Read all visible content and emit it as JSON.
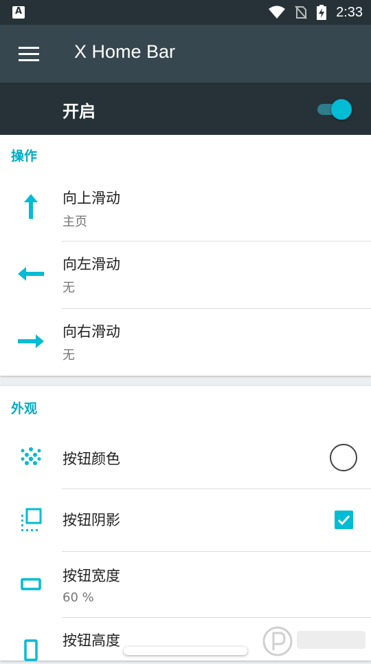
{
  "status_bar": {
    "time": "2:33",
    "left_icon_letter": "A"
  },
  "app_bar": {
    "title": "X Home Bar"
  },
  "master": {
    "label": "开启",
    "enabled": true
  },
  "sections": {
    "actions": {
      "title": "操作",
      "items": [
        {
          "title": "向上滑动",
          "summary": "主页"
        },
        {
          "title": "向左滑动",
          "summary": "无"
        },
        {
          "title": "向右滑动",
          "summary": "无"
        }
      ]
    },
    "appearance": {
      "title": "外观",
      "items": [
        {
          "title": "按钮颜色"
        },
        {
          "title": "按钮阴影",
          "checked": true
        },
        {
          "title": "按钮宽度",
          "summary": "60 %"
        },
        {
          "title": "按钮高度"
        }
      ]
    }
  },
  "colors": {
    "accent": "#00BCD4",
    "appbar": "#37474F",
    "statusbar": "#263238",
    "section_title": "#00ACC1"
  },
  "icons": [
    "menu-icon",
    "arrow-up-icon",
    "arrow-left-icon",
    "arrow-right-icon",
    "palette-dots-icon",
    "shadow-icon",
    "width-icon",
    "height-icon"
  ]
}
